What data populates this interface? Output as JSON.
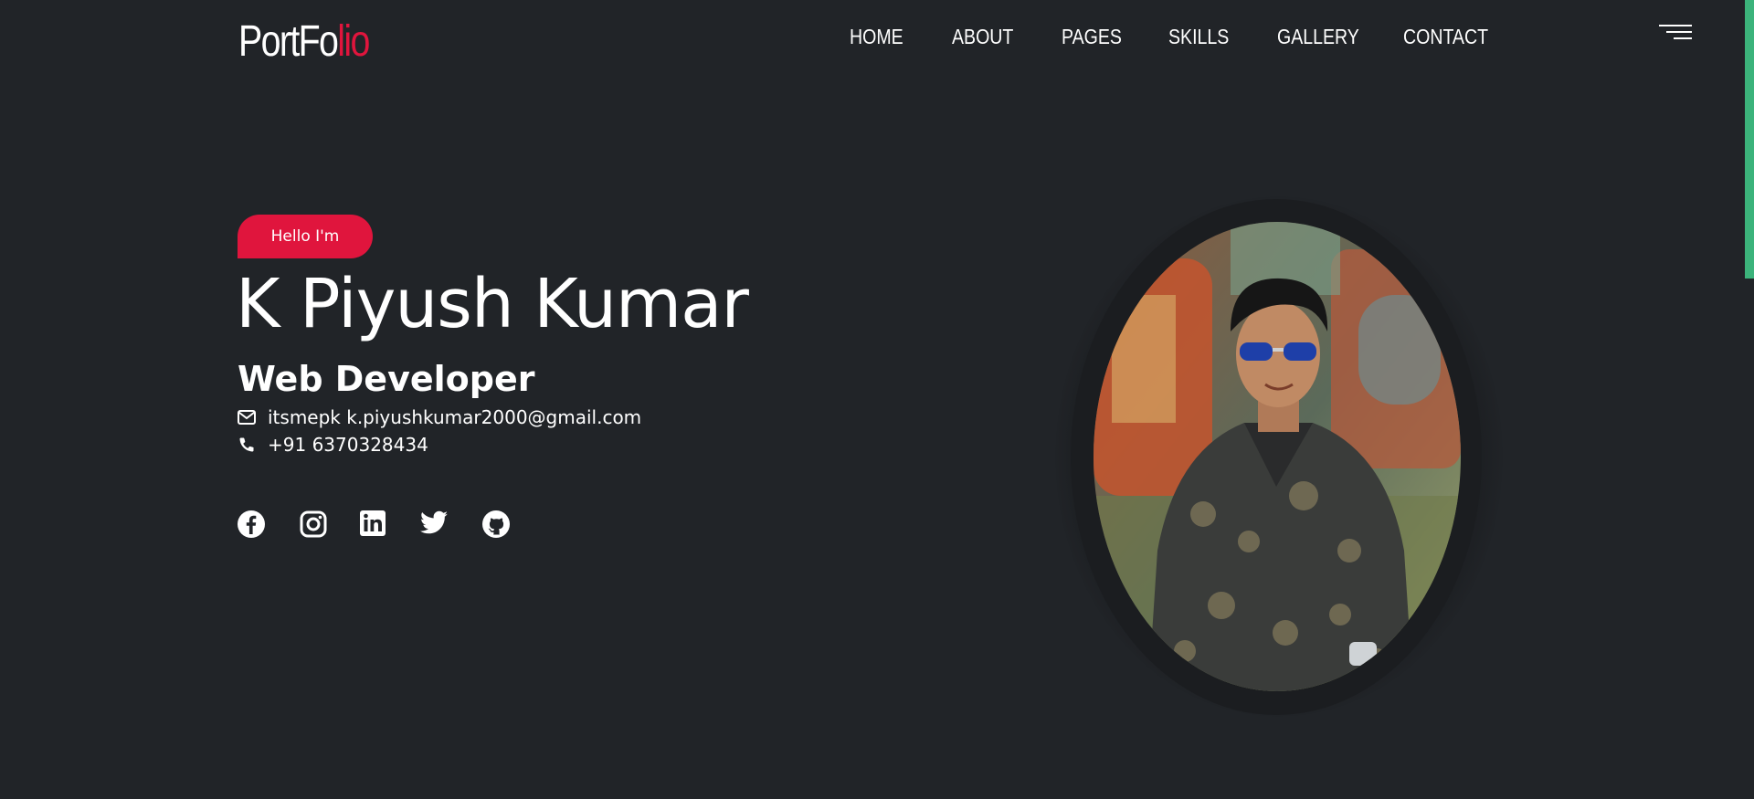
{
  "header": {
    "logo_main": "PortFo",
    "logo_accent": "lio",
    "nav": [
      "HOME",
      "ABOUT",
      "PAGES",
      "SKILLS",
      "GALLERY",
      "CONTACT"
    ]
  },
  "hero": {
    "greeting": "Hello I'm",
    "name": "K Piyush Kumar",
    "role": "Web Developer",
    "email": "itsmepk k.piyushkumar2000@gmail.com",
    "phone": "+91 6370328434"
  },
  "socials": [
    "facebook-icon",
    "instagram-icon",
    "linkedin-icon",
    "twitter-icon",
    "github-icon"
  ],
  "colors": {
    "background": "#212428",
    "accent": "#e0153d",
    "scroll_indicator": "#3cb37b",
    "text": "#ffffff"
  }
}
